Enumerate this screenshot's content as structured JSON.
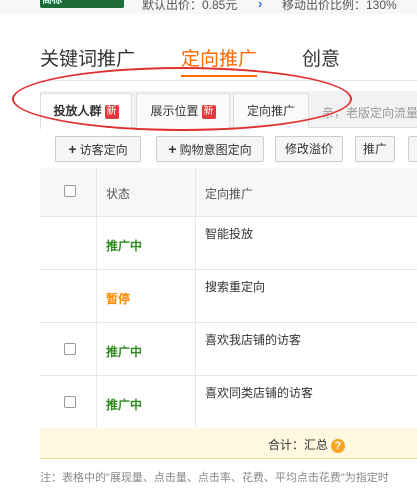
{
  "topbar": {
    "logo_text": "商标",
    "default_bid": "默认出价：0.85元",
    "mobile_ratio": "移动出价比例：130%"
  },
  "main_tabs": [
    {
      "label": "关键词推广"
    },
    {
      "label": "定向推广"
    },
    {
      "label": "创意"
    }
  ],
  "sub_tabs": [
    {
      "label": "投放人群",
      "badge": "新"
    },
    {
      "label": "展示位置",
      "badge": "新"
    },
    {
      "label": "定向推广"
    }
  ],
  "sub_hint": "亲，老版定向流量",
  "toolbar": {
    "add_visitor": "访客定向",
    "add_intent": "购物意图定向",
    "modify_premium": "修改溢价",
    "promote": "推广"
  },
  "table": {
    "headers": {
      "status": "状态",
      "name": "定向推广"
    },
    "rows": [
      {
        "status": "推广中",
        "status_color": "#2e8b1e",
        "name": "智能投放"
      },
      {
        "status": "暂停",
        "status_color": "#ff8c00",
        "name": "搜索重定向"
      },
      {
        "status": "推广中",
        "status_color": "#2e8b1e",
        "name": "喜欢我店铺的访客"
      },
      {
        "status": "推广中",
        "status_color": "#2e8b1e",
        "name": "喜欢同类店铺的访客"
      }
    ]
  },
  "summary": {
    "label": "合计：汇总",
    "icon": "help-icon"
  },
  "footnote": "注：表格中的\"展现量、点击量、点击率、花费、平均点击花费\"为指定时"
}
